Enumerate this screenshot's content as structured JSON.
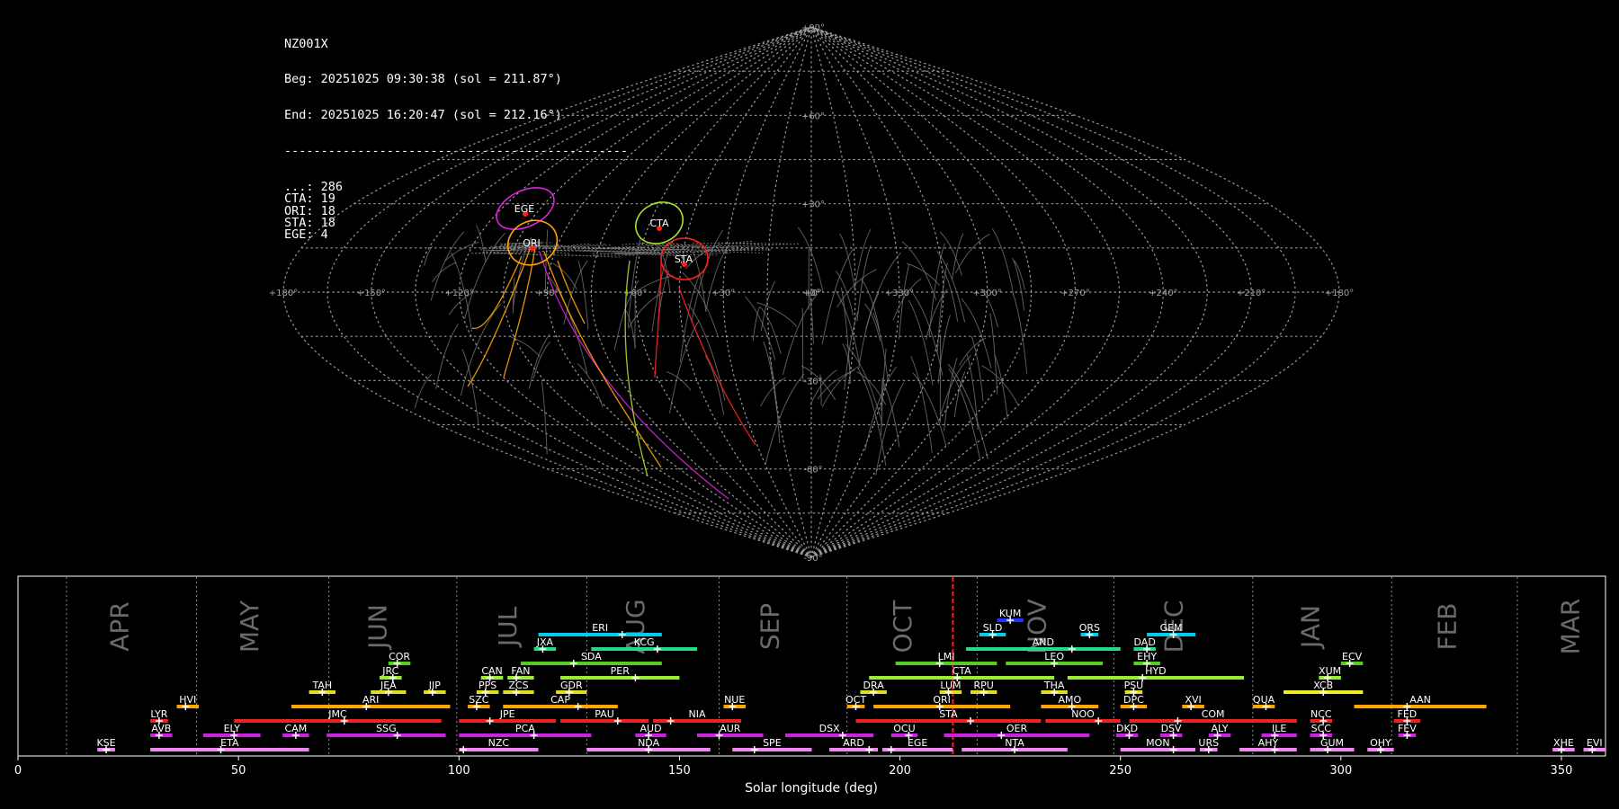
{
  "stats_box": {
    "station": "NZ001X",
    "begin": "Beg: 20251025 09:30:38 (sol = 211.87°)",
    "end": "End: 20251025 16:20:47 (sol = 212.16°)",
    "separator": "-----------------------------------------------",
    "counts": [
      {
        "code": "...",
        "count": 286
      },
      {
        "code": "CTA",
        "count": 19
      },
      {
        "code": "ORI",
        "count": 18
      },
      {
        "code": "STA",
        "count": 18
      },
      {
        "code": "EGE",
        "count": 4
      }
    ]
  },
  "chart_data": [
    {
      "type": "scatter",
      "projection": "sinusoidal radiant map",
      "lat_labels": [
        "+90°",
        "+60°",
        "+30°",
        "+0°",
        "-30°",
        "-60°",
        "-90°"
      ],
      "lon_labels": [
        "+180°",
        "+150°",
        "+120°",
        "+90°",
        "+60°",
        "+30°",
        "+0°",
        "+330°",
        "+300°",
        "+270°",
        "+240°",
        "+210°",
        "+180°"
      ],
      "grid": true,
      "showers": [
        {
          "code": "EGE",
          "color": "#dd22dd"
        },
        {
          "code": "ORI",
          "color": "#ffa500"
        },
        {
          "code": "CTA",
          "color": "#a8e02a"
        },
        {
          "code": "STA",
          "color": "#ff2020"
        }
      ]
    },
    {
      "type": "timeline",
      "xlabel": "Solar longitude (deg)",
      "xlim": [
        0,
        360
      ],
      "xticks": [
        0,
        50,
        100,
        150,
        200,
        250,
        300,
        350
      ],
      "current_sol": 212.0,
      "month_boundaries": [
        11,
        40.5,
        70.5,
        99.5,
        129,
        159,
        188,
        217.5,
        248.5,
        280,
        311.5,
        340
      ],
      "months": [
        {
          "label": "APR",
          "x": 25
        },
        {
          "label": "MAY",
          "x": 54.5
        },
        {
          "label": "JUN",
          "x": 83.5
        },
        {
          "label": "JUL",
          "x": 113
        },
        {
          "label": "AUG",
          "x": 142
        },
        {
          "label": "SEP",
          "x": 172.5
        },
        {
          "label": "OCT",
          "x": 202.5
        },
        {
          "label": "NOV",
          "x": 233
        },
        {
          "label": "DEC",
          "x": 264
        },
        {
          "label": "JAN",
          "x": 295
        },
        {
          "label": "FEB",
          "x": 326
        },
        {
          "label": "MAR",
          "x": 354
        }
      ],
      "showers": [
        {
          "code": "KUM",
          "start": 222,
          "end": 228,
          "peak": 225,
          "row": 10,
          "color": "#2233ff"
        },
        {
          "code": "ERI",
          "start": 118,
          "end": 146,
          "peak": 137,
          "row": 9,
          "color": "#00ccee"
        },
        {
          "code": "SLD",
          "start": 218,
          "end": 224,
          "peak": 221,
          "row": 9,
          "color": "#00ccee"
        },
        {
          "code": "ORS",
          "start": 241,
          "end": 245,
          "peak": 243,
          "row": 9,
          "color": "#00ccee"
        },
        {
          "code": "GEM",
          "start": 256,
          "end": 267,
          "peak": 262,
          "row": 9,
          "color": "#00ccee"
        },
        {
          "code": "JXA",
          "start": 117,
          "end": 122,
          "peak": 119,
          "row": 8,
          "color": "#22dd88"
        },
        {
          "code": "KCG",
          "start": 130,
          "end": 154,
          "peak": 145,
          "row": 8,
          "color": "#22dd88"
        },
        {
          "code": "AND",
          "start": 215,
          "end": 250,
          "peak": 239,
          "row": 8,
          "color": "#22dd88"
        },
        {
          "code": "DAD",
          "start": 253,
          "end": 258,
          "peak": 256,
          "row": 8,
          "color": "#22dd88"
        },
        {
          "code": "COR",
          "start": 84,
          "end": 89,
          "peak": 86,
          "row": 7,
          "color": "#55cc22"
        },
        {
          "code": "SDA",
          "start": 114,
          "end": 146,
          "peak": 126,
          "row": 7,
          "color": "#55cc22"
        },
        {
          "code": "LMI",
          "start": 199,
          "end": 222,
          "peak": 209,
          "row": 7,
          "color": "#55cc22"
        },
        {
          "code": "LEO",
          "start": 224,
          "end": 246,
          "peak": 235,
          "row": 7,
          "color": "#55cc22"
        },
        {
          "code": "EHY",
          "start": 253,
          "end": 259,
          "peak": 256,
          "row": 7,
          "color": "#55cc22"
        },
        {
          "code": "ECV",
          "start": 300,
          "end": 305,
          "peak": 302,
          "row": 7,
          "color": "#55cc22"
        },
        {
          "code": "JRC",
          "start": 82,
          "end": 87,
          "peak": 85,
          "row": 6,
          "color": "#99ee33"
        },
        {
          "code": "CAN",
          "start": 105,
          "end": 110,
          "peak": 107,
          "row": 6,
          "color": "#99ee33"
        },
        {
          "code": "FAN",
          "start": 111,
          "end": 117,
          "peak": 113,
          "row": 6,
          "color": "#99ee33"
        },
        {
          "code": "PER",
          "start": 123,
          "end": 150,
          "peak": 140,
          "row": 6,
          "color": "#99ee33"
        },
        {
          "code": "CTA",
          "start": 193,
          "end": 235,
          "peak": 213,
          "row": 6,
          "color": "#99ee33"
        },
        {
          "code": "HYD",
          "start": 238,
          "end": 278,
          "peak": 255,
          "row": 6,
          "color": "#99ee33"
        },
        {
          "code": "XUM",
          "start": 295,
          "end": 300,
          "peak": 297,
          "row": 6,
          "color": "#99ee33"
        },
        {
          "code": "TAH",
          "start": 66,
          "end": 72,
          "peak": 69,
          "row": 5,
          "color": "#dddd22"
        },
        {
          "code": "JEA",
          "start": 80,
          "end": 88,
          "peak": 84,
          "row": 5,
          "color": "#dddd22"
        },
        {
          "code": "JIP",
          "start": 92,
          "end": 97,
          "peak": 94,
          "row": 5,
          "color": "#dddd22"
        },
        {
          "code": "PPS",
          "start": 104,
          "end": 109,
          "peak": 106,
          "row": 5,
          "color": "#dddd22"
        },
        {
          "code": "ZCS",
          "start": 110,
          "end": 117,
          "peak": 113,
          "row": 5,
          "color": "#dddd22"
        },
        {
          "code": "GDR",
          "start": 122,
          "end": 129,
          "peak": 125,
          "row": 5,
          "color": "#dddd22"
        },
        {
          "code": "DRA",
          "start": 191,
          "end": 197,
          "peak": 194,
          "row": 5,
          "color": "#dddd22"
        },
        {
          "code": "LUM",
          "start": 209,
          "end": 214,
          "peak": 211,
          "row": 5,
          "color": "#dddd22"
        },
        {
          "code": "RPU",
          "start": 216,
          "end": 222,
          "peak": 219,
          "row": 5,
          "color": "#dddd22"
        },
        {
          "code": "THA",
          "start": 232,
          "end": 238,
          "peak": 235,
          "row": 5,
          "color": "#dddd22"
        },
        {
          "code": "PSU",
          "start": 251,
          "end": 255,
          "peak": 253,
          "row": 5,
          "color": "#dddd22"
        },
        {
          "code": "XCB",
          "start": 287,
          "end": 305,
          "peak": 296,
          "row": 5,
          "color": "#eeee22"
        },
        {
          "code": "HVI",
          "start": 36,
          "end": 41,
          "peak": 38,
          "row": 4,
          "color": "#ffa500"
        },
        {
          "code": "ARI",
          "start": 62,
          "end": 98,
          "peak": 79,
          "row": 4,
          "color": "#ffa500"
        },
        {
          "code": "SZC",
          "start": 102,
          "end": 107,
          "peak": 104,
          "row": 4,
          "color": "#ffa500"
        },
        {
          "code": "CAP",
          "start": 110,
          "end": 136,
          "peak": 127,
          "row": 4,
          "color": "#ffa500"
        },
        {
          "code": "NUE",
          "start": 160,
          "end": 165,
          "peak": 162,
          "row": 4,
          "color": "#ffa500"
        },
        {
          "code": "OCT",
          "start": 188,
          "end": 192,
          "peak": 190,
          "row": 4,
          "color": "#ffa500"
        },
        {
          "code": "ORI",
          "start": 194,
          "end": 225,
          "peak": 209,
          "row": 4,
          "color": "#ffa500"
        },
        {
          "code": "AMO",
          "start": 232,
          "end": 245,
          "peak": 239,
          "row": 4,
          "color": "#ffa500"
        },
        {
          "code": "DPC",
          "start": 250,
          "end": 256,
          "peak": 253,
          "row": 4,
          "color": "#ffa500"
        },
        {
          "code": "XVI",
          "start": 264,
          "end": 269,
          "peak": 266,
          "row": 4,
          "color": "#ffa500"
        },
        {
          "code": "QUA",
          "start": 280,
          "end": 285,
          "peak": 283,
          "row": 4,
          "color": "#ffa500"
        },
        {
          "code": "AAN",
          "start": 303,
          "end": 333,
          "peak": 315,
          "row": 4,
          "color": "#ffa500"
        },
        {
          "code": "LYR",
          "start": 30,
          "end": 34,
          "peak": 32,
          "row": 3,
          "color": "#ee2222"
        },
        {
          "code": "JMC",
          "start": 49,
          "end": 96,
          "peak": 74,
          "row": 3,
          "color": "#ee2222"
        },
        {
          "code": "JPE",
          "start": 100,
          "end": 122,
          "peak": 107,
          "row": 3,
          "color": "#ee2222"
        },
        {
          "code": "PAU",
          "start": 123,
          "end": 143,
          "peak": 136,
          "row": 3,
          "color": "#ee2222"
        },
        {
          "code": "NIA",
          "start": 144,
          "end": 164,
          "peak": 148,
          "row": 3,
          "color": "#ee2222"
        },
        {
          "code": "STA",
          "start": 190,
          "end": 232,
          "peak": 216,
          "row": 3,
          "color": "#ee2222"
        },
        {
          "code": "NOO",
          "start": 233,
          "end": 250,
          "peak": 245,
          "row": 3,
          "color": "#ee2222"
        },
        {
          "code": "COM",
          "start": 252,
          "end": 290,
          "peak": 263,
          "row": 3,
          "color": "#ee2222"
        },
        {
          "code": "NCC",
          "start": 293,
          "end": 298,
          "peak": 296,
          "row": 3,
          "color": "#ee2222"
        },
        {
          "code": "FED",
          "start": 312,
          "end": 318,
          "peak": 315,
          "row": 3,
          "color": "#ee2222"
        },
        {
          "code": "AVB",
          "start": 30,
          "end": 35,
          "peak": 32,
          "row": 2,
          "color": "#cc22dd"
        },
        {
          "code": "ELY",
          "start": 42,
          "end": 55,
          "peak": 49,
          "row": 2,
          "color": "#cc22dd"
        },
        {
          "code": "CAM",
          "start": 60,
          "end": 66,
          "peak": 63,
          "row": 2,
          "color": "#cc22dd"
        },
        {
          "code": "SSG",
          "start": 70,
          "end": 97,
          "peak": 86,
          "row": 2,
          "color": "#cc22dd"
        },
        {
          "code": "PCA",
          "start": 100,
          "end": 130,
          "peak": 117,
          "row": 2,
          "color": "#cc22dd"
        },
        {
          "code": "AUD",
          "start": 140,
          "end": 147,
          "peak": 143,
          "row": 2,
          "color": "#cc22dd"
        },
        {
          "code": "AUR",
          "start": 154,
          "end": 169,
          "peak": 159,
          "row": 2,
          "color": "#cc22dd"
        },
        {
          "code": "DSX",
          "start": 174,
          "end": 194,
          "peak": 187,
          "row": 2,
          "color": "#cc22dd"
        },
        {
          "code": "OCU",
          "start": 198,
          "end": 204,
          "peak": 202,
          "row": 2,
          "color": "#cc22dd"
        },
        {
          "code": "OER",
          "start": 210,
          "end": 243,
          "peak": 223,
          "row": 2,
          "color": "#cc22dd"
        },
        {
          "code": "DKD",
          "start": 249,
          "end": 254,
          "peak": 252,
          "row": 2,
          "color": "#cc22dd"
        },
        {
          "code": "DSV",
          "start": 259,
          "end": 264,
          "peak": 262,
          "row": 2,
          "color": "#cc22dd"
        },
        {
          "code": "ALY",
          "start": 270,
          "end": 275,
          "peak": 272,
          "row": 2,
          "color": "#cc22dd"
        },
        {
          "code": "ILE",
          "start": 282,
          "end": 290,
          "peak": 285,
          "row": 2,
          "color": "#cc22dd"
        },
        {
          "code": "SCC",
          "start": 293,
          "end": 298,
          "peak": 296,
          "row": 2,
          "color": "#cc22dd"
        },
        {
          "code": "FEV",
          "start": 313,
          "end": 317,
          "peak": 315,
          "row": 2,
          "color": "#cc22dd"
        },
        {
          "code": "KSE",
          "start": 18,
          "end": 22,
          "peak": 20,
          "row": 1,
          "color": "#ee88ee"
        },
        {
          "code": "ETA",
          "start": 30,
          "end": 66,
          "peak": 46,
          "row": 1,
          "color": "#ee88ee"
        },
        {
          "code": "NZC",
          "start": 100,
          "end": 118,
          "peak": 101,
          "row": 1,
          "color": "#ee88ee"
        },
        {
          "code": "NDA",
          "start": 129,
          "end": 157,
          "peak": 143,
          "row": 1,
          "color": "#ee88ee"
        },
        {
          "code": "SPE",
          "start": 162,
          "end": 180,
          "peak": 167,
          "row": 1,
          "color": "#ee88ee"
        },
        {
          "code": "ARD",
          "start": 184,
          "end": 195,
          "peak": 193,
          "row": 1,
          "color": "#ee88ee"
        },
        {
          "code": "EGE",
          "start": 196,
          "end": 212,
          "peak": 198,
          "row": 1,
          "color": "#ee88ee"
        },
        {
          "code": "NTA",
          "start": 214,
          "end": 238,
          "peak": 226,
          "row": 1,
          "color": "#ee88ee"
        },
        {
          "code": "MON",
          "start": 250,
          "end": 267,
          "peak": 262,
          "row": 1,
          "color": "#ee88ee"
        },
        {
          "code": "URS",
          "start": 268,
          "end": 272,
          "peak": 270,
          "row": 1,
          "color": "#ee88ee"
        },
        {
          "code": "AHY",
          "start": 277,
          "end": 290,
          "peak": 285,
          "row": 1,
          "color": "#ee88ee"
        },
        {
          "code": "GUM",
          "start": 293,
          "end": 303,
          "peak": 297,
          "row": 1,
          "color": "#ee88ee"
        },
        {
          "code": "OHY",
          "start": 306,
          "end": 312,
          "peak": 309,
          "row": 1,
          "color": "#ee88ee"
        },
        {
          "code": "XHE",
          "start": 348,
          "end": 353,
          "peak": 350,
          "row": 1,
          "color": "#ee88ee"
        },
        {
          "code": "EVI",
          "start": 355,
          "end": 360,
          "peak": 357,
          "row": 1,
          "color": "#ee88ee"
        }
      ]
    }
  ]
}
